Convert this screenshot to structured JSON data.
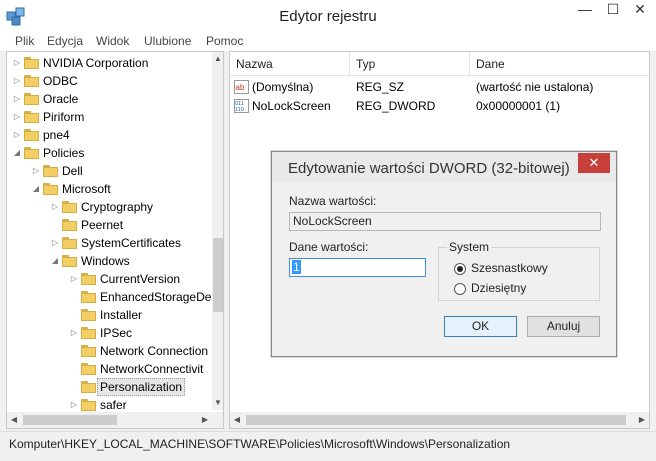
{
  "window": {
    "title": "Edytor rejestru",
    "controls": {
      "minimize": "—",
      "maximize": "☐",
      "close": "✕"
    }
  },
  "menu": [
    "Plik",
    "Edycja",
    "Widok",
    "Ulubione",
    "Pomoc"
  ],
  "tree": {
    "items": [
      {
        "label": "NVIDIA Corporation",
        "depth": 0,
        "expander": "collapsed"
      },
      {
        "label": "ODBC",
        "depth": 0,
        "expander": "collapsed"
      },
      {
        "label": "Oracle",
        "depth": 0,
        "expander": "collapsed"
      },
      {
        "label": "Piriform",
        "depth": 0,
        "expander": "collapsed"
      },
      {
        "label": "pne4",
        "depth": 0,
        "expander": "collapsed"
      },
      {
        "label": "Policies",
        "depth": 0,
        "expander": "expanded"
      },
      {
        "label": "Dell",
        "depth": 1,
        "expander": "collapsed"
      },
      {
        "label": "Microsoft",
        "depth": 1,
        "expander": "expanded"
      },
      {
        "label": "Cryptography",
        "depth": 2,
        "expander": "collapsed"
      },
      {
        "label": "Peernet",
        "depth": 2,
        "expander": "none"
      },
      {
        "label": "SystemCertificates",
        "depth": 2,
        "expander": "collapsed"
      },
      {
        "label": "Windows",
        "depth": 2,
        "expander": "expanded"
      },
      {
        "label": "CurrentVersion",
        "depth": 3,
        "expander": "collapsed"
      },
      {
        "label": "EnhancedStorageDe",
        "depth": 3,
        "expander": "none"
      },
      {
        "label": "Installer",
        "depth": 3,
        "expander": "none"
      },
      {
        "label": "IPSec",
        "depth": 3,
        "expander": "collapsed"
      },
      {
        "label": "Network Connection",
        "depth": 3,
        "expander": "none"
      },
      {
        "label": "NetworkConnectivit",
        "depth": 3,
        "expander": "none"
      },
      {
        "label": "Personalization",
        "depth": 3,
        "expander": "none",
        "selected": true
      },
      {
        "label": "safer",
        "depth": 3,
        "expander": "collapsed"
      }
    ]
  },
  "values": {
    "columns": [
      "Nazwa",
      "Typ",
      "Dane"
    ],
    "rows": [
      {
        "icon": "string-value-icon",
        "name": "(Domyślna)",
        "type": "REG_SZ",
        "data": "(wartość nie ustalona)"
      },
      {
        "icon": "binary-value-icon",
        "name": "NoLockScreen",
        "type": "REG_DWORD",
        "data": "0x00000001 (1)"
      }
    ]
  },
  "statusbar": {
    "path": "Komputer\\HKEY_LOCAL_MACHINE\\SOFTWARE\\Policies\\Microsoft\\Windows\\Personalization"
  },
  "dialog": {
    "title": "Edytowanie wartości DWORD (32-bitowej)",
    "close": "✕",
    "name_label": "Nazwa wartości:",
    "name_value": "NoLockScreen",
    "data_label": "Dane wartości:",
    "data_value": "1",
    "base_label": "System",
    "base_options": [
      "Szesnastkowy",
      "Dziesiętny"
    ],
    "base_selected": "Szesnastkowy",
    "ok_label": "OK",
    "cancel_label": "Anuluj"
  },
  "colors": {
    "folder": "#f3cf63",
    "dialog_close": "#c7403a",
    "selection": "#3399ff"
  }
}
